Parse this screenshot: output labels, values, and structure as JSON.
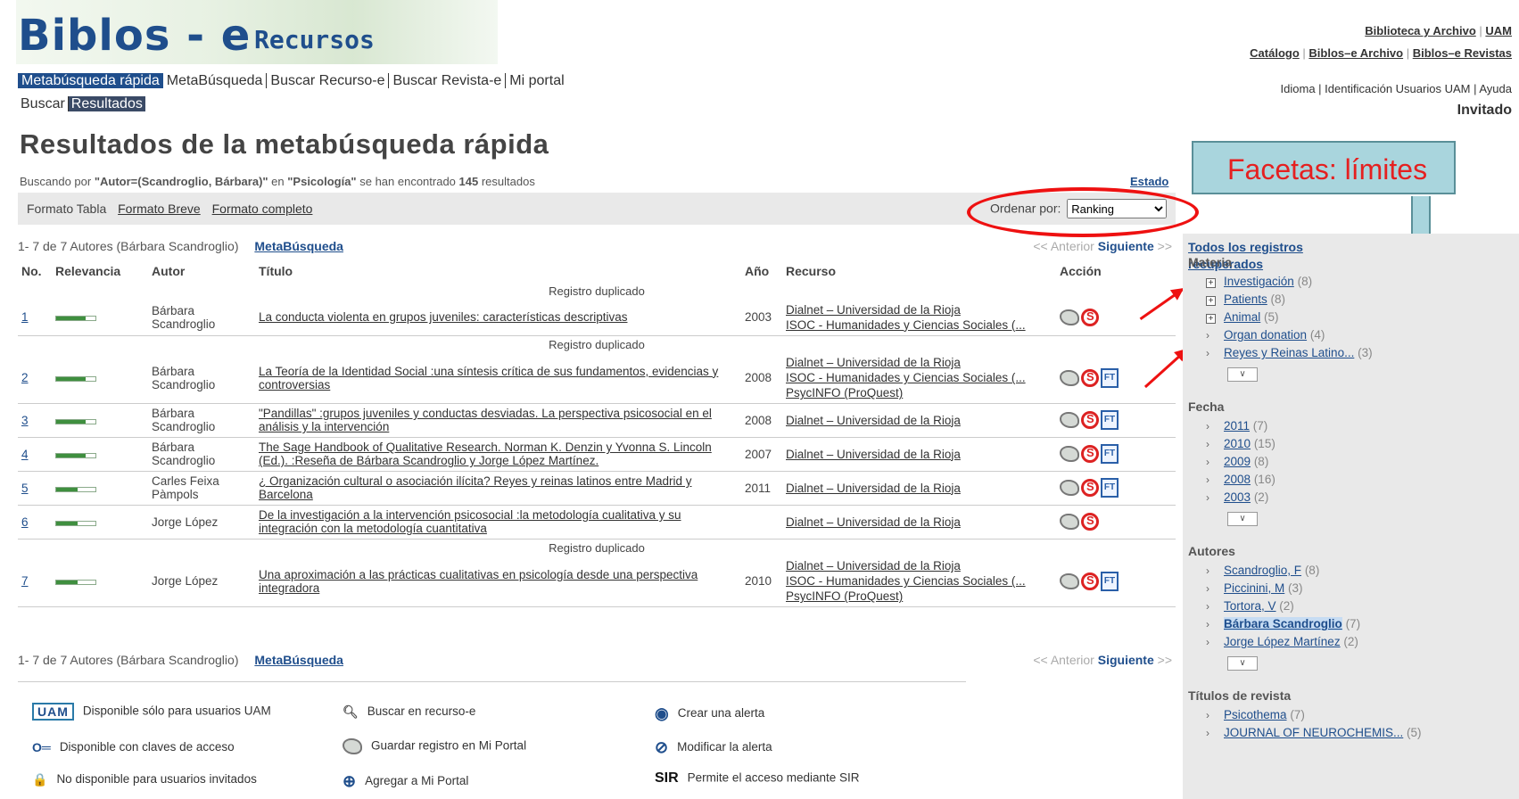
{
  "header": {
    "logo_text": "Biblos - e",
    "logo_sub": "Recursos",
    "top_links_row1": [
      "Biblioteca y Archivo",
      "UAM"
    ],
    "top_links_row2": [
      "Catálogo",
      "Biblos–e Archivo",
      "Biblos–e Revistas"
    ],
    "nav1": [
      "Metabúsqueda rápida",
      "MetaBúsqueda",
      "Buscar Recurso-e",
      "Buscar Revista-e",
      "Mi portal"
    ],
    "nav2": [
      "Buscar",
      "Resultados"
    ],
    "user_links": [
      "Idioma",
      "Identificación Usuarios UAM",
      "Ayuda"
    ],
    "user_status": "Invitado"
  },
  "page": {
    "title": "Resultados de la metabúsqueda rápida",
    "search_prefix": "Buscando por ",
    "search_query": "\"Autor=(Scandroglio, Bárbara)\"",
    "search_in": " en ",
    "search_db": "\"Psicología\"",
    "search_found": " se han encontrado ",
    "search_count": "145",
    "search_suffix": " resultados",
    "estado": "Estado"
  },
  "formats": {
    "label": "Formato Tabla",
    "brief": "Formato Breve",
    "full": "Formato completo",
    "order_label": "Ordenar por:",
    "order_value": "Ranking"
  },
  "callout": {
    "text": "Facetas: límites"
  },
  "pagination": {
    "range": "1- 7 de 7 Autores (Bárbara Scandroglio)",
    "meta_link": "MetaBúsqueda",
    "prev": "<< Anterior",
    "next": "Siguiente",
    "next_arrow": ">>"
  },
  "table": {
    "headers": [
      "No.",
      "Relevancia",
      "Autor",
      "Título",
      "Año",
      "Recurso",
      "Acción"
    ],
    "dup_label": "Registro duplicado",
    "rows": [
      {
        "no": "1",
        "author": "Bárbara Scandroglio",
        "title": "La conducta violenta en grupos juveniles: características descriptivas",
        "year": "2003",
        "resources": [
          "Dialnet – Universidad de la Rioja",
          "ISOC - Humanidades y Ciencias Sociales (..."
        ],
        "dup": true,
        "ft": false
      },
      {
        "no": "2",
        "author": "Bárbara Scandroglio",
        "title": "La Teoría de la Identidad Social :una síntesis crítica de sus fundamentos, evidencias y controversias",
        "year": "2008",
        "resources": [
          "Dialnet – Universidad de la Rioja",
          "ISOC - Humanidades y Ciencias Sociales (...",
          "PsycINFO (ProQuest)"
        ],
        "dup": true,
        "ft": true
      },
      {
        "no": "3",
        "author": "Bárbara Scandroglio",
        "title": "\"Pandillas\" :grupos juveniles y conductas desviadas. La perspectiva psicosocial en el análisis y la intervención",
        "year": "2008",
        "resources": [
          "Dialnet – Universidad de la Rioja"
        ],
        "dup": false,
        "ft": true
      },
      {
        "no": "4",
        "author": "Bárbara Scandroglio",
        "title": "The Sage Handbook of Qualitative Research. Norman K. Denzin y Yvonna S. Lincoln (Ed.). :Reseña de Bárbara Scandroglio y Jorge López Martínez.",
        "year": "2007",
        "resources": [
          "Dialnet – Universidad de la Rioja"
        ],
        "dup": false,
        "ft": true
      },
      {
        "no": "5",
        "author": "Carles Feixa Pàmpols",
        "title": "¿ Organización cultural o asociación ilícita? Reyes y reinas latinos entre Madrid y Barcelona",
        "year": "2011",
        "resources": [
          "Dialnet – Universidad de la Rioja"
        ],
        "dup": false,
        "ft": true
      },
      {
        "no": "6",
        "author": "Jorge López",
        "title": "De la investigación a la intervención psicosocial :la metodología cualitativa y su integración con la metodología cuantitativa",
        "year": "",
        "resources": [
          "Dialnet – Universidad de la Rioja"
        ],
        "dup": false,
        "ft": false
      },
      {
        "no": "7",
        "author": "Jorge López",
        "title": "Una aproximación a las prácticas cualitativas en psicología desde una perspectiva integradora",
        "year": "2010",
        "resources": [
          "Dialnet – Universidad de la Rioja",
          "ISOC - Humanidades y Ciencias Sociales (...",
          "PsycINFO (ProQuest)"
        ],
        "dup": true,
        "ft": true
      }
    ]
  },
  "sidebar": {
    "all": "Todos los registros recuperados",
    "groups": [
      {
        "title": "Materia",
        "items": [
          {
            "label": "Investigación",
            "count": "(8)",
            "expand": true
          },
          {
            "label": "Patients",
            "count": "(8)",
            "expand": true
          },
          {
            "label": "Animal",
            "count": "(5)",
            "expand": true
          },
          {
            "label": "Organ donation",
            "count": "(4)"
          },
          {
            "label": "Reyes y Reinas Latino...",
            "count": "(3)"
          }
        ]
      },
      {
        "title": "Fecha",
        "items": [
          {
            "label": "2011",
            "count": "(7)"
          },
          {
            "label": "2010",
            "count": "(15)"
          },
          {
            "label": "2009",
            "count": "(8)"
          },
          {
            "label": "2008",
            "count": "(16)"
          },
          {
            "label": "2003",
            "count": "(2)"
          }
        ]
      },
      {
        "title": "Autores",
        "items": [
          {
            "label": "Scandroglio, F",
            "count": "(8)"
          },
          {
            "label": "Piccinini, M",
            "count": "(3)"
          },
          {
            "label": "Tortora, V",
            "count": "(2)"
          },
          {
            "label": "Bárbara Scandroglio",
            "count": "(7)",
            "selected": true
          },
          {
            "label": "Jorge López Martínez",
            "count": "(2)"
          }
        ]
      },
      {
        "title": "Títulos de revista",
        "items": [
          {
            "label": "Psicothema",
            "count": "(7)"
          },
          {
            "label": "JOURNAL OF NEUROCHEMIS...",
            "count": "(5)"
          }
        ]
      }
    ]
  },
  "legend": [
    {
      "icon": "UAM",
      "text": "Disponible sólo para usuarios UAM"
    },
    {
      "icon": "key",
      "text": "Disponible con claves de acceso"
    },
    {
      "icon": "lock",
      "text": "No disponible para usuarios invitados"
    },
    {
      "icon": "search",
      "text": "Buscar en recurso-e"
    },
    {
      "icon": "save",
      "text": "Guardar registro en Mi Portal"
    },
    {
      "icon": "plus",
      "text": "Agregar a Mi Portal"
    },
    {
      "icon": "alert",
      "text": "Crear una alerta"
    },
    {
      "icon": "edit",
      "text": "Modificar la alerta"
    },
    {
      "icon": "SIR",
      "text": "Permite el acceso mediante SIR"
    }
  ],
  "colors": {
    "brand": "#1f4e8c",
    "callout_bg": "#a9d5dd",
    "annotation": "#e11111"
  }
}
